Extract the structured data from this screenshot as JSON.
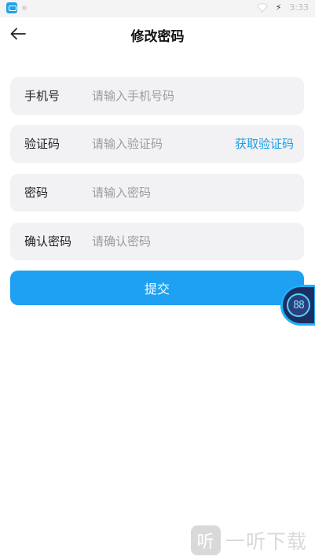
{
  "status_bar": {
    "time": "3:33"
  },
  "header": {
    "title": "修改密码"
  },
  "form": {
    "phone": {
      "label": "手机号",
      "placeholder": "请输入手机号码"
    },
    "code": {
      "label": "验证码",
      "placeholder": "请输入验证码",
      "action": "获取验证码"
    },
    "password": {
      "label": "密码",
      "placeholder": "请输入密码"
    },
    "confirm": {
      "label": "确认密码",
      "placeholder": "请确认密码"
    },
    "submit_label": "提交"
  },
  "float_widget": {
    "text": "88"
  },
  "watermark": {
    "badge": "听",
    "text": "一听下载"
  },
  "colors": {
    "accent": "#1ea1f2",
    "link": "#1b9ee6",
    "field_bg": "#f2f2f4"
  },
  "icons": {
    "back": "arrow-left-icon",
    "wifi": "wifi-icon",
    "battery": "battery-charging-icon"
  }
}
